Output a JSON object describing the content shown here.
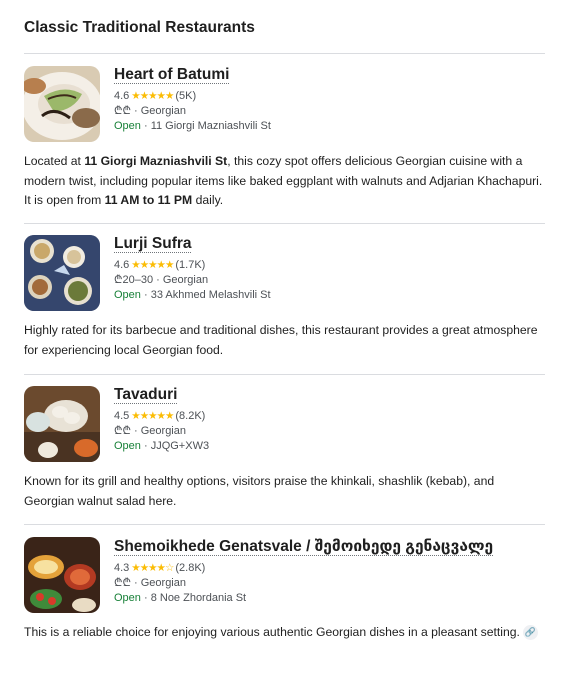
{
  "section": {
    "title": "Classic Traditional Restaurants"
  },
  "restaurants": [
    {
      "name": "Heart of Batumi",
      "rating": "4.6",
      "stars": "★★★★★",
      "reviews": "(5K)",
      "price_cuisine": "₾₾ · Georgian",
      "open_status": "Open",
      "address": " · 11 Giorgi Mazniashvili St",
      "desc": {
        "p1": "Located at ",
        "b1": "11 Giorgi Mazniashvili St",
        "p2": ", this cozy spot offers delicious Georgian cuisine with a modern twist, including popular items like baked eggplant with walnuts and Adjarian Khachapuri. It is open from ",
        "b2": "11 AM to 11 PM",
        "p3": " daily."
      }
    },
    {
      "name": "Lurji Sufra",
      "rating": "4.6",
      "stars": "★★★★★",
      "reviews": "(1.7K)",
      "price_cuisine": "₾20–30 · Georgian",
      "open_status": "Open",
      "address": " · 33 Akhmed Melashvili St",
      "desc": "Highly rated for its barbecue and traditional dishes, this restaurant provides a great atmosphere for experiencing local Georgian food."
    },
    {
      "name": "Tavaduri",
      "rating": "4.5",
      "stars": "★★★★★",
      "reviews": "(8.2K)",
      "price_cuisine": "₾₾ · Georgian",
      "open_status": "Open",
      "address": " · JJQG+XW3",
      "desc": "Known for its grill and healthy options, visitors praise the khinkali, shashlik (kebab), and Georgian walnut salad here."
    },
    {
      "name": "Shemoikhede Genatsvale / შემოიხედე გენაცვალე",
      "rating": "4.3",
      "stars": "★★★★☆",
      "reviews": "(2.8K)",
      "price_cuisine": "₾₾ · Georgian",
      "open_status": "Open",
      "address": " · 8 Noe Zhordania St",
      "desc": "This is a reliable choice for enjoying various authentic Georgian dishes in a pleasant setting."
    }
  ],
  "icons": {
    "link_chip": "link-icon"
  }
}
